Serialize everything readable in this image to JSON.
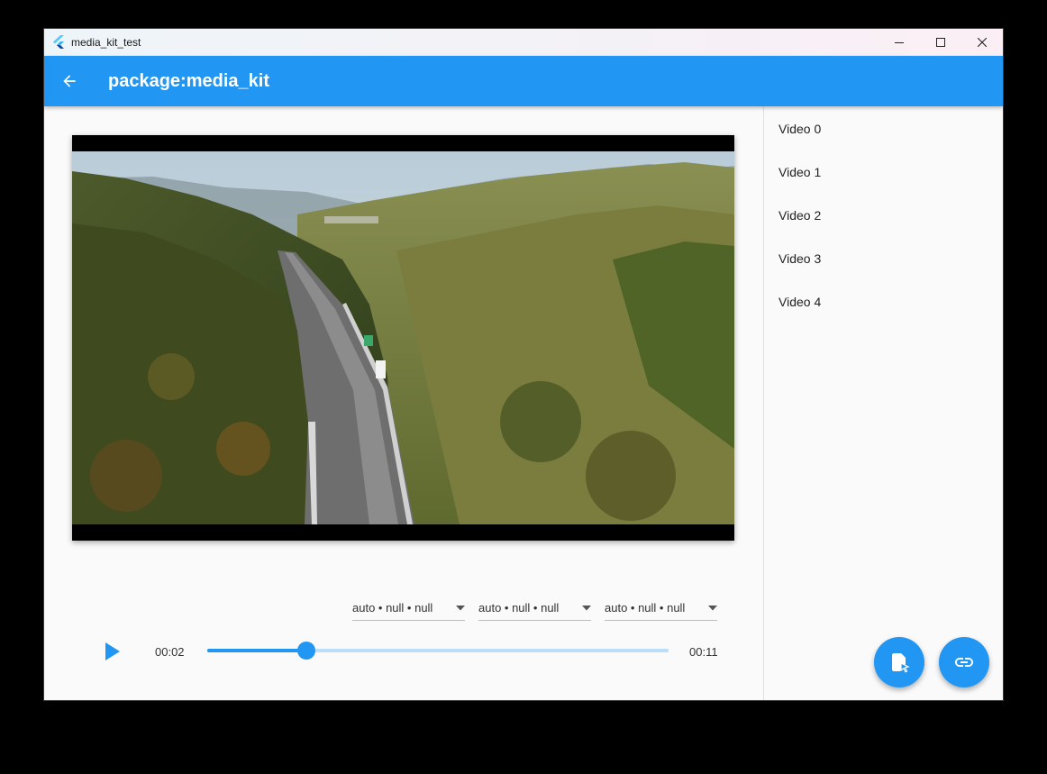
{
  "window": {
    "title": "media_kit_test",
    "icon": "flutter-icon",
    "controls": [
      "minimize-icon",
      "maximize-icon",
      "close-icon"
    ]
  },
  "appbar": {
    "title": "package:media_kit",
    "back_icon": "arrow-back-icon",
    "color": "#2196f3"
  },
  "player": {
    "tracks": [
      {
        "label": "auto • null • null"
      },
      {
        "label": "auto • null • null"
      },
      {
        "label": "auto • null • null"
      }
    ],
    "position": "00:02",
    "duration": "00:11",
    "progress_fraction": 0.2148,
    "play_icon": "play-icon"
  },
  "playlist": {
    "items": [
      {
        "label": "Video 0"
      },
      {
        "label": "Video 1"
      },
      {
        "label": "Video 2"
      },
      {
        "label": "Video 3"
      },
      {
        "label": "Video 4"
      }
    ]
  },
  "fabs": [
    {
      "icon": "open-file-icon"
    },
    {
      "icon": "link-icon"
    }
  ]
}
